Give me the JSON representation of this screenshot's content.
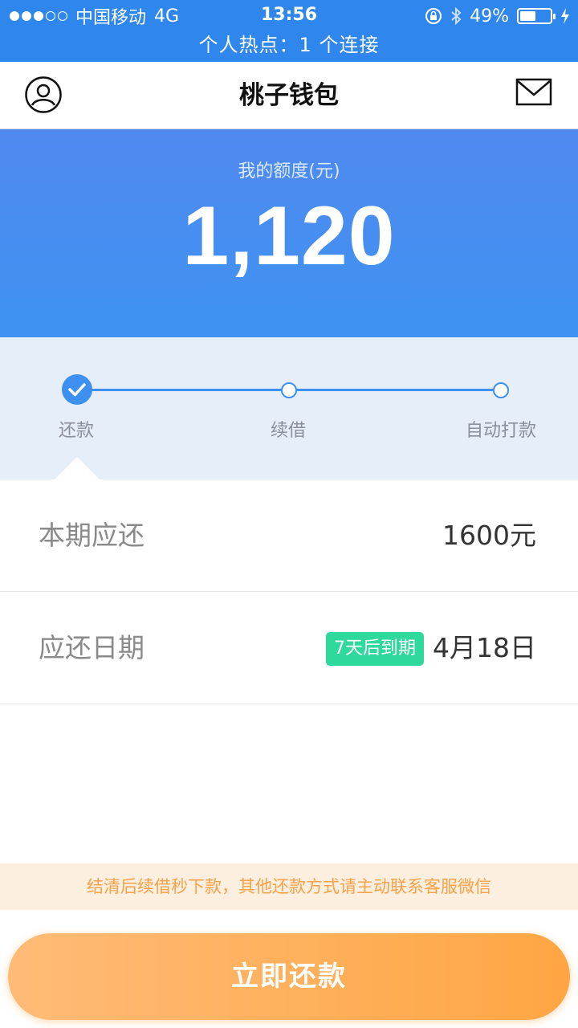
{
  "status_bar": {
    "carrier": "中国移动",
    "network": "4G",
    "time": "13:56",
    "battery": "49%",
    "battery_level": 0.49
  },
  "hotspot": {
    "text": "个人热点：1 个连接"
  },
  "nav": {
    "title": "桃子钱包",
    "left_icon": "user-avatar-icon",
    "right_icon": "mail-icon"
  },
  "credit": {
    "label": "我的额度(元)",
    "amount": "1,120"
  },
  "steps": [
    {
      "label": "还款",
      "active": true
    },
    {
      "label": "续借",
      "active": false
    },
    {
      "label": "自动打款",
      "active": false
    }
  ],
  "rows": [
    {
      "label": "本期应还",
      "value": "1600元"
    },
    {
      "label": "应还日期",
      "badge": "7天后到期",
      "value": "4月18日"
    }
  ],
  "notice": "结清后续借秒下款，其他还款方式请主动联系客服微信",
  "button": {
    "label": "立即还款"
  },
  "colors": {
    "primary": "#2f86ec",
    "badge": "#2fd89c",
    "notice_text": "#f6a248",
    "button": "#ffa643"
  }
}
